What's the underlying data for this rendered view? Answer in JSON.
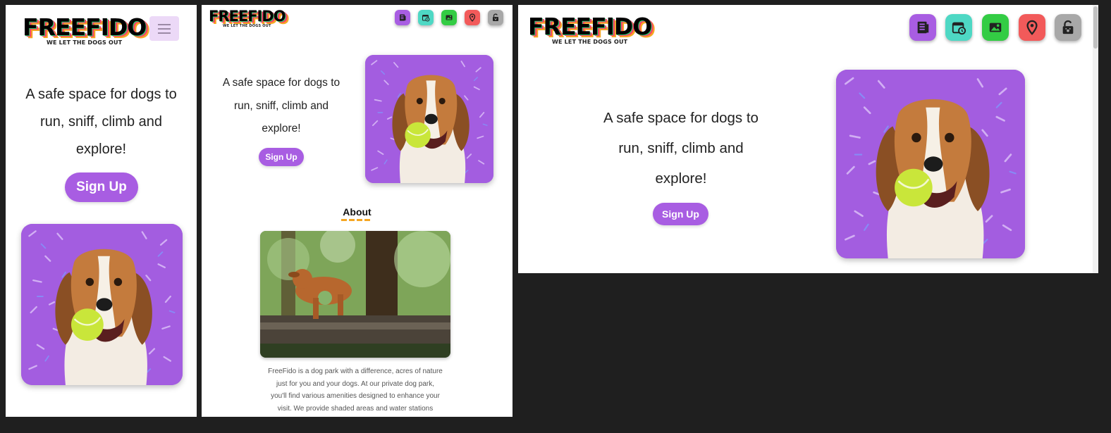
{
  "logo": {
    "wordmark": "FREEFIDO",
    "tagline": "WE LET THE DOGS OUT"
  },
  "hero": {
    "tagline_line1": "A safe space for dogs to",
    "tagline_line2": "run, sniff, climb and",
    "tagline_line3": "explore!",
    "signup_label": "Sign Up"
  },
  "nav": {
    "icons": [
      {
        "name": "news-icon",
        "color": "#a85de2"
      },
      {
        "name": "calendar-clock-icon",
        "color": "#4ed8c4"
      },
      {
        "name": "gallery-icon",
        "color": "#33cc44"
      },
      {
        "name": "location-pin-icon",
        "color": "#f25a5a"
      },
      {
        "name": "unlock-paw-icon",
        "color": "#a8a8a8"
      }
    ]
  },
  "about": {
    "title": "About",
    "line1": "FreeFido is a dog park with a difference, acres of nature",
    "line2": "just for you and your dogs. At our private dog park,",
    "line3": "you'll find various amenities designed to enhance your",
    "line4": "visit. We provide shaded areas and water stations"
  },
  "colors": {
    "accent": "#a85de2",
    "underline": "#f5a623",
    "background": "#1f1f1f"
  }
}
